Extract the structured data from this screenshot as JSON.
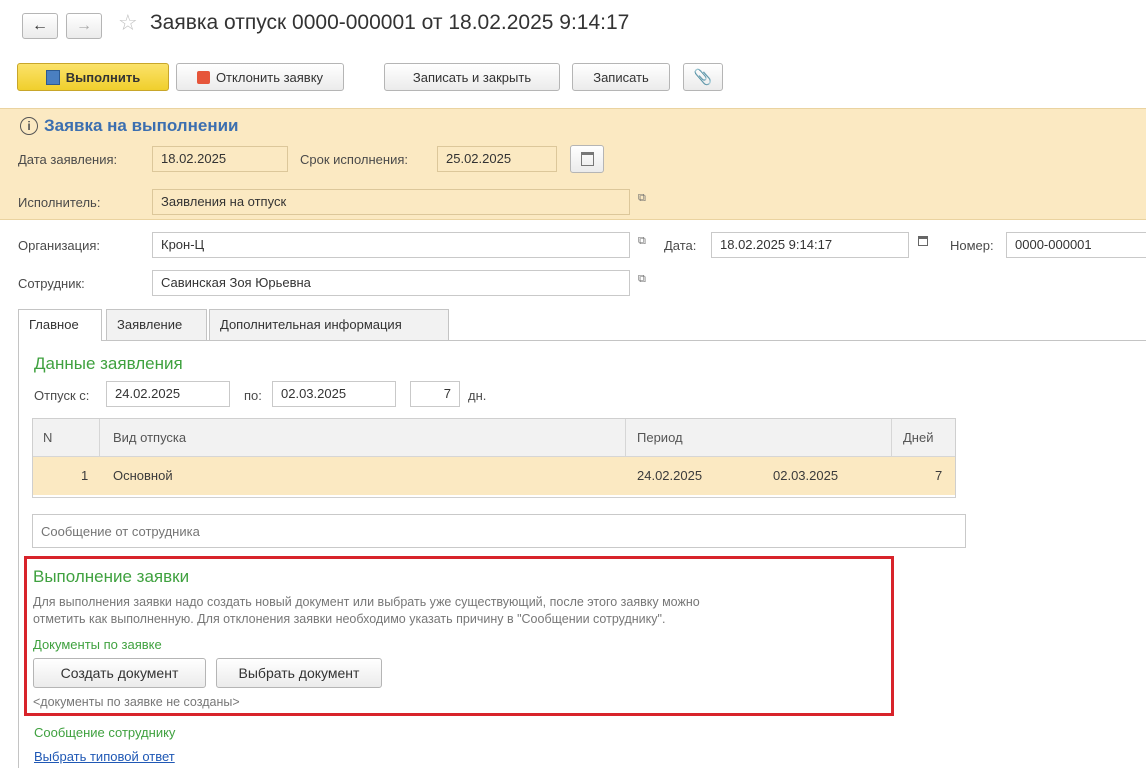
{
  "window": {
    "title": "Заявка отпуск 0000-000001 от 18.02.2025 9:14:17"
  },
  "toolbar": {
    "execute_label": "Выполнить",
    "reject_label": "Отклонить заявку",
    "save_close_label": "Записать и закрыть",
    "save_label": "Записать"
  },
  "status": {
    "title": "Заявка на выполнении",
    "request_date_label": "Дата заявления:",
    "request_date_value": "18.02.2025",
    "deadline_label": "Срок исполнения:",
    "deadline_value": "25.02.2025",
    "executor_label": "Исполнитель:",
    "executor_value": "Заявления на отпуск"
  },
  "header": {
    "organization_label": "Организация:",
    "organization_value": "Крон-Ц",
    "date_label": "Дата:",
    "date_value": "18.02.2025  9:14:17",
    "number_label": "Номер:",
    "number_value": "0000-000001",
    "employee_label": "Сотрудник:",
    "employee_value": "Савинская Зоя Юрьевна"
  },
  "tabs": [
    {
      "label": "Главное"
    },
    {
      "label": "Заявление"
    },
    {
      "label": "Дополнительная информация"
    }
  ],
  "request_data": {
    "title": "Данные заявления",
    "from_label": "Отпуск с:",
    "from_value": "24.02.2025",
    "to_label": "по:",
    "to_value": "02.03.2025",
    "days_value": "7",
    "days_unit": "дн."
  },
  "table": {
    "col_n": "N",
    "col_type": "Вид отпуска",
    "col_period": "Период",
    "col_days": "Дней",
    "rows": [
      {
        "n": "1",
        "type": "Основной",
        "from": "24.02.2025",
        "to": "02.03.2025",
        "days": "7"
      }
    ]
  },
  "message_from_employee": {
    "placeholder": "Сообщение от сотрудника"
  },
  "execution": {
    "title": "Выполнение заявки",
    "description_line1": "Для выполнения заявки надо создать новый документ или выбрать уже существующий, после этого заявку можно",
    "description_line2": "отметить как выполненную. Для отклонения заявки необходимо указать причину в \"Сообщении сотруднику\".",
    "documents_label": "Документы по заявке",
    "create_button": "Создать документ",
    "select_button": "Выбрать документ",
    "no_documents": "<документы по заявке не созданы>"
  },
  "employee_message": {
    "label": "Сообщение сотруднику",
    "choose_link": "Выбрать типовой ответ"
  },
  "colors": {
    "accent_yellow": "#fbe9c2",
    "execute_button": "#f5d53d",
    "green_text": "#3fa13f",
    "status_blue": "#3c6fb0",
    "highlight_border": "#d8232a"
  }
}
